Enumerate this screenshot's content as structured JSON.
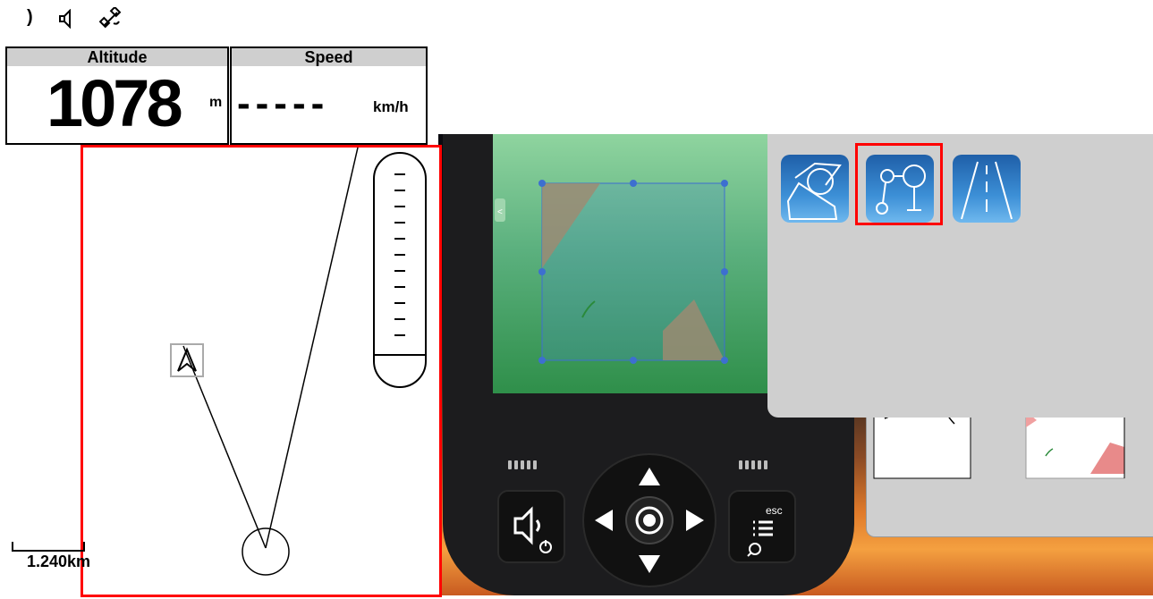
{
  "status_icons": [
    {
      "name": "signal-icon",
      "glyph": ")"
    },
    {
      "name": "speaker-icon",
      "glyph": "🔈"
    },
    {
      "name": "satellite-icon",
      "glyph": "🛰"
    }
  ],
  "altitude": {
    "title": "Altitude",
    "value": "1078",
    "unit": "m"
  },
  "speed": {
    "title": "Speed",
    "value": "-----",
    "unit": "km/h"
  },
  "map": {
    "scale_label": "1.240km"
  },
  "settings_tiles": [
    {
      "name": "tile-terrain",
      "icon": "terrain-icon",
      "selected": false
    },
    {
      "name": "tile-route",
      "icon": "route-icon",
      "selected": true
    },
    {
      "name": "tile-road",
      "icon": "road-icon",
      "selected": false
    }
  ],
  "device": {
    "left_button_icon": "volume-power-icon",
    "right_button_label": "esc",
    "right_button_icon": "menu-search-icon",
    "nav_arrows": [
      "up",
      "down",
      "left",
      "right"
    ]
  },
  "colors": {
    "highlight": "#ff0000",
    "tile_blue": "#2a78c4",
    "panel_gray": "#cfcfcf"
  }
}
